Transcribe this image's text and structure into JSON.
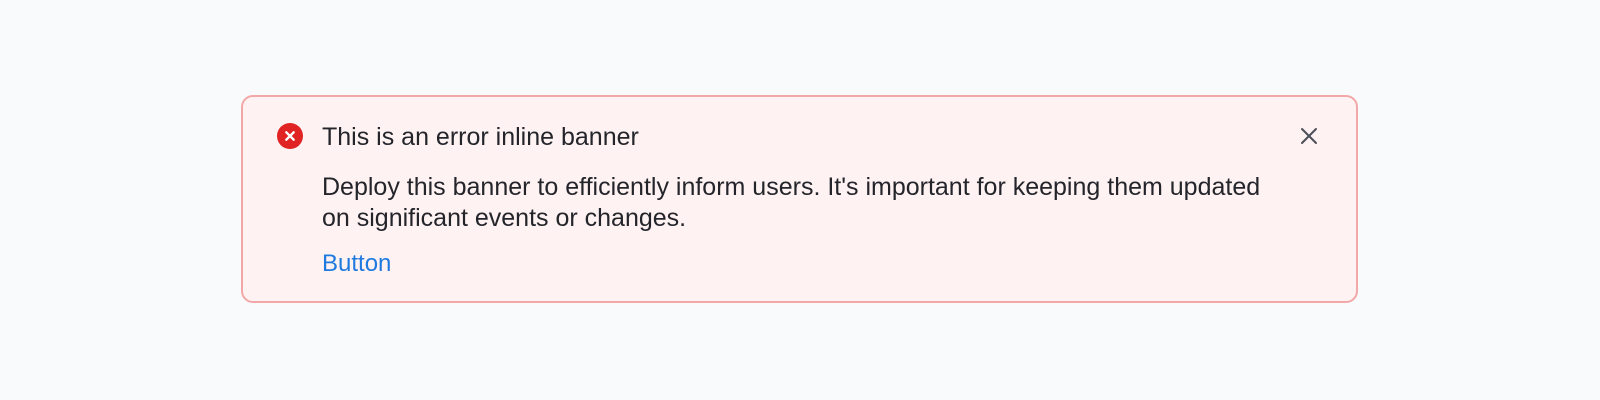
{
  "banner": {
    "title": "This is an error inline banner",
    "body": "Deploy this banner to efficiently inform users. It's important for keeping them updated on significant events or changes.",
    "action_label": "Button",
    "icons": {
      "status": "error-circle-icon",
      "close": "close-icon"
    }
  },
  "colors": {
    "page_background": "#f9fafc",
    "banner_background": "#fff2f2",
    "banner_border": "#f2a8a8",
    "error": "#e02424",
    "text": "#23252b",
    "link": "#1f7ae0"
  }
}
